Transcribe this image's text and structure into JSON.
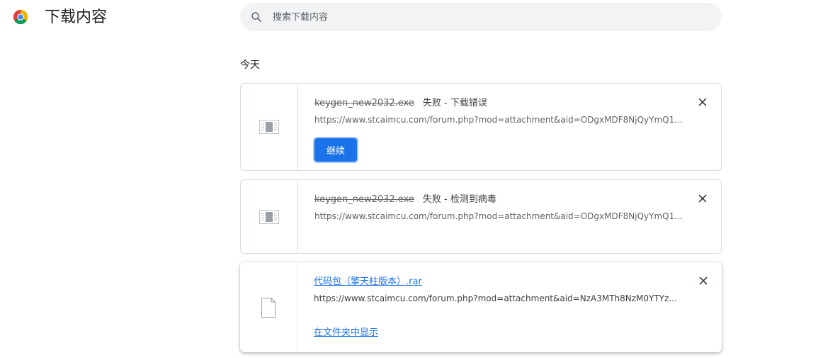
{
  "header": {
    "title": "下载内容",
    "logo_icon": "chrome-logo",
    "search_placeholder": "搜索下载内容"
  },
  "date_group": "今天",
  "downloads": [
    {
      "file_name": "keygen_new2032.exe",
      "status": "失败 - 下载错误",
      "url": "https://www.stcaimcu.com/forum.php?mod=attachment&aid=ODgxMDF8NjQyYmQ1...",
      "action_label": "继续",
      "icon": "blocked-file-icon"
    },
    {
      "file_name": "keygen_new2032.exe",
      "status": "失败 - 检测到病毒",
      "url": "https://www.stcaimcu.com/forum.php?mod=attachment&aid=ODgxMDF8NjQyYmQ1...",
      "icon": "blocked-file-icon"
    },
    {
      "file_name": "代码包（擎天柱版本）.rar",
      "url": "https://www.stcaimcu.com/forum.php?mod=attachment&aid=NzA3MTh8NzM0YTYz...",
      "action_label": "在文件夹中显示",
      "icon": "file-icon"
    }
  ],
  "colors": {
    "accent": "#1a73e8",
    "search_bg": "#f1f3f4",
    "border": "#dadce0"
  }
}
